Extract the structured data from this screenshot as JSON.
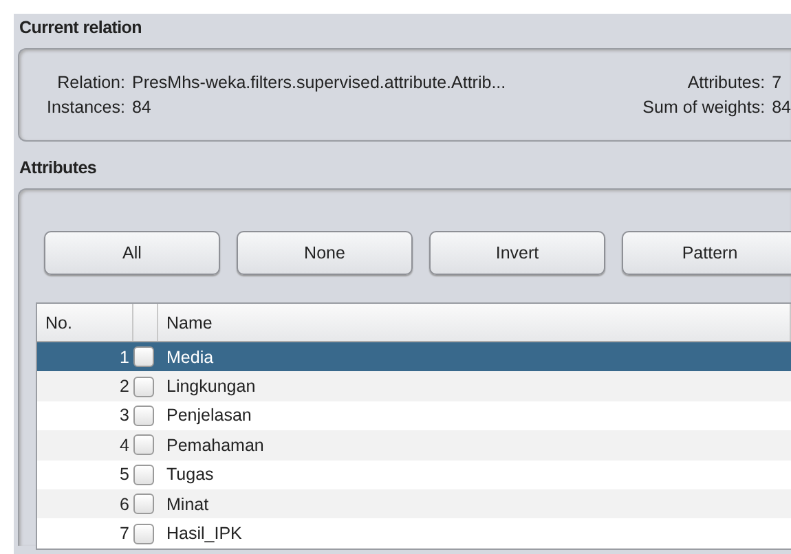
{
  "current_relation": {
    "title": "Current relation",
    "relation_label": "Relation:",
    "relation": "PresMhs-weka.filters.supervised.attribute.Attrib...",
    "instances_label": "Instances:",
    "instances": "84",
    "attributes_label": "Attributes:",
    "attributes": "7",
    "weights_label": "Sum of weights:",
    "weights": "84"
  },
  "attributes": {
    "title": "Attributes",
    "buttons": [
      "All",
      "None",
      "Invert",
      "Pattern"
    ],
    "table": {
      "columns": [
        "No.",
        "Name"
      ],
      "rows": [
        {
          "no": "1",
          "name": "Media",
          "checked": false,
          "selected": true
        },
        {
          "no": "2",
          "name": "Lingkungan",
          "checked": false,
          "selected": false
        },
        {
          "no": "3",
          "name": "Penjelasan",
          "checked": false,
          "selected": false
        },
        {
          "no": "4",
          "name": "Pemahaman",
          "checked": false,
          "selected": false
        },
        {
          "no": "5",
          "name": "Tugas",
          "checked": false,
          "selected": false
        },
        {
          "no": "6",
          "name": "Minat",
          "checked": false,
          "selected": false
        },
        {
          "no": "7",
          "name": "Hasil_IPK",
          "checked": false,
          "selected": false
        }
      ]
    }
  }
}
